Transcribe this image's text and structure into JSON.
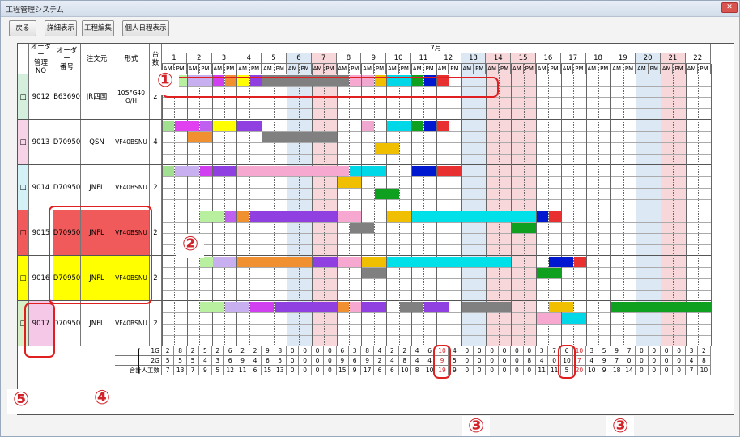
{
  "window": {
    "title": "工程管理システム",
    "close_label": "✕"
  },
  "toolbar": {
    "back": "戻る",
    "detail": "詳細表示",
    "edit": "工程編集",
    "personal": "個人日程表示"
  },
  "headers": {
    "order_mgmt_no": "オーダー\n管理NO",
    "order_no": "オーダー\n番号",
    "orderer": "注文元",
    "model": "形式",
    "units": "台数",
    "month": "7月",
    "am": "AM",
    "pm": "PM"
  },
  "days": [
    "1",
    "2",
    "3",
    "4",
    "5",
    "6",
    "7",
    "8",
    "9",
    "10",
    "11",
    "12",
    "13",
    "14",
    "15",
    "16",
    "17",
    "18",
    "19",
    "20",
    "21",
    "22"
  ],
  "day_types": [
    "w",
    "w",
    "w",
    "w",
    "w",
    "sat",
    "sun",
    "w",
    "w",
    "w",
    "w",
    "w",
    "sat",
    "sun",
    "sun",
    "w",
    "w",
    "w",
    "w",
    "sat",
    "sun",
    "w"
  ],
  "colors": {
    "saturday": "#dce8f4",
    "sunday": "#f8d7da",
    "row_green": "#d4f0dc",
    "row_pink": "#f7d3e8",
    "row_cyan": "#d3f1f7",
    "row_red": "#f05a5a",
    "row_yellow": "#ffff00",
    "row_yellowgreen": "#d7f0c8",
    "highlight_pink": "#f5c8e8",
    "annotation_red": "#d2232a"
  },
  "orders": [
    {
      "check": "□",
      "mgmt_no": "9012",
      "order_no": "B63690",
      "orderer": "JR四国",
      "model": "10SFG40 O/H",
      "units": "2"
    },
    {
      "check": "□",
      "mgmt_no": "9013",
      "order_no": "D70950",
      "orderer": "QSN",
      "model": "VF40BSNU",
      "units": "4"
    },
    {
      "check": "□",
      "mgmt_no": "9014",
      "order_no": "D70950",
      "orderer": "JNFL",
      "model": "VF40BSNU",
      "units": "2"
    },
    {
      "check": "□",
      "mgmt_no": "9015",
      "order_no": "D70950",
      "orderer": "JNFL",
      "model": "VF40BSNU",
      "units": "2"
    },
    {
      "check": "□",
      "mgmt_no": "9016",
      "order_no": "D70950",
      "orderer": "JNFL",
      "model": "VF40BSNU",
      "units": "2"
    },
    {
      "check": "□",
      "mgmt_no": "9017",
      "order_no": "D70950",
      "orderer": "JNFL",
      "model": "VF40BSNU",
      "units": "2"
    }
  ],
  "summary": [
    {
      "label": "1G",
      "values": [
        "2",
        "8",
        "2",
        "5",
        "2",
        "6",
        "2",
        "2",
        "9",
        "8",
        "0",
        "0",
        "0",
        "0",
        "6",
        "3",
        "8",
        "4",
        "2",
        "2",
        "4",
        "6",
        "10",
        "4",
        "0",
        "0",
        "0",
        "0",
        "0",
        "0",
        "3",
        "7",
        "6",
        "10",
        "3",
        "5",
        "9",
        "7",
        "0",
        "0",
        "0",
        "0",
        "3",
        "2"
      ]
    },
    {
      "label": "2G",
      "values": [
        "5",
        "5",
        "5",
        "4",
        "3",
        "6",
        "9",
        "4",
        "6",
        "5",
        "0",
        "0",
        "0",
        "0",
        "9",
        "6",
        "9",
        "2",
        "4",
        "8",
        "4",
        "4",
        "9",
        "5",
        "0",
        "0",
        "0",
        "0",
        "0",
        "8",
        "4",
        "0",
        "10",
        "7",
        "4",
        "9",
        "7",
        "0",
        "0",
        "0",
        "0",
        "0",
        "4",
        "8"
      ]
    },
    {
      "label": "合計人工数",
      "values": [
        "7",
        "13",
        "7",
        "9",
        "5",
        "12",
        "11",
        "6",
        "15",
        "13",
        "0",
        "0",
        "0",
        "0",
        "15",
        "9",
        "17",
        "6",
        "6",
        "10",
        "8",
        "10",
        "19",
        "9",
        "0",
        "0",
        "0",
        "0",
        "0",
        "0",
        "11",
        "11",
        "5",
        "20",
        "10",
        "9",
        "18",
        "14",
        "0",
        "0",
        "0",
        "0",
        "7",
        "10"
      ]
    }
  ],
  "annotations": [
    "①",
    "②",
    "③",
    "③",
    "④",
    "⑤"
  ]
}
